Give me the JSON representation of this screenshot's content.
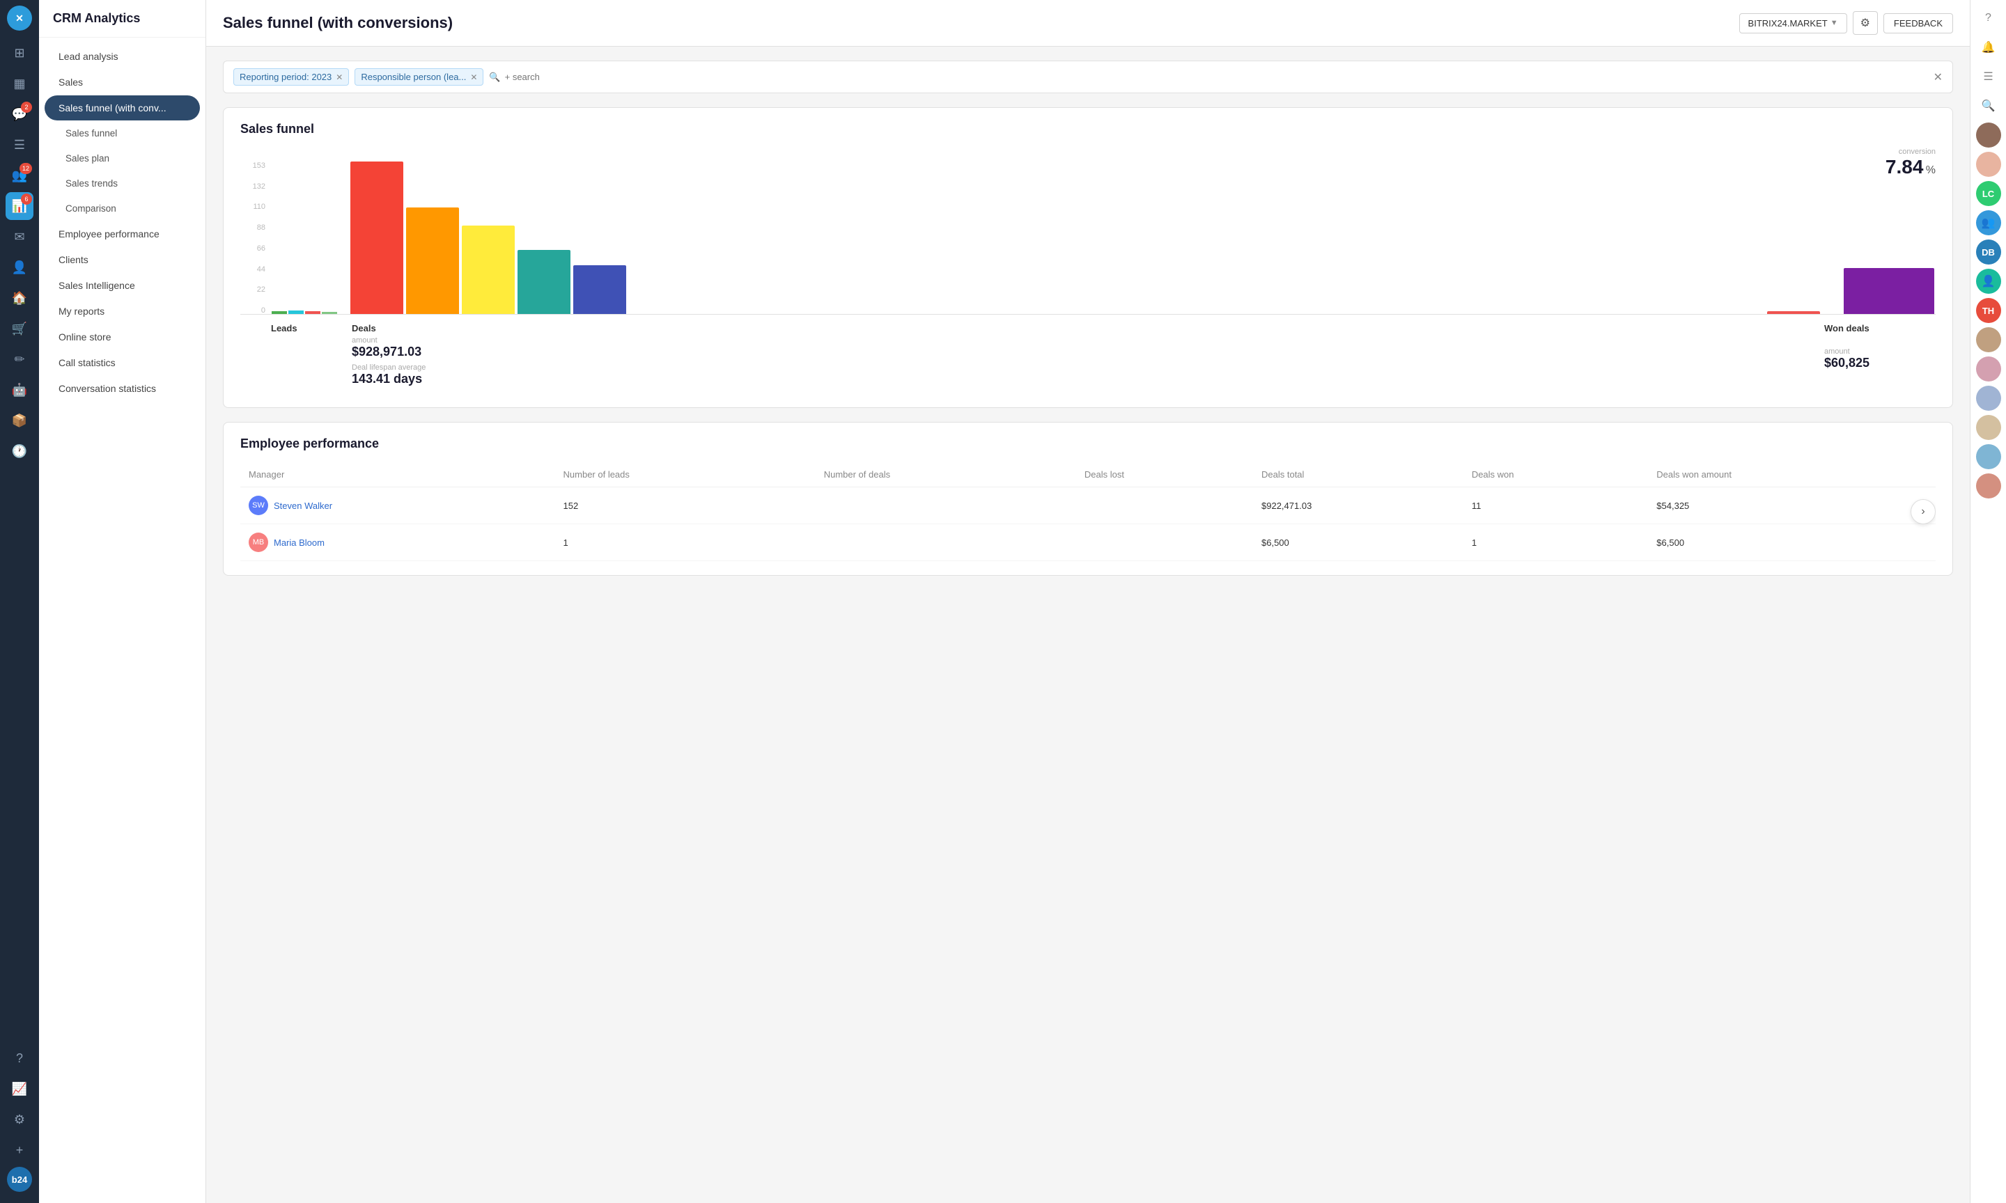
{
  "app": {
    "title": "CRM Analytics"
  },
  "header": {
    "page_title": "Sales funnel (with conversions)",
    "market_btn": "BITRIX24.MARKET",
    "feedback_btn": "FEEDBACK"
  },
  "filters": [
    {
      "label": "Reporting period: 2023",
      "id": "period"
    },
    {
      "label": "Responsible person (lea...",
      "id": "person"
    }
  ],
  "filter_placeholder": "+ search",
  "sidebar": {
    "items": [
      {
        "label": "Lead analysis",
        "id": "lead-analysis",
        "active": false,
        "sub": false
      },
      {
        "label": "Sales",
        "id": "sales",
        "active": false,
        "sub": false
      },
      {
        "label": "Sales funnel (with conv...",
        "id": "sales-funnel-conv",
        "active": true,
        "sub": false
      },
      {
        "label": "Sales funnel",
        "id": "sales-funnel",
        "active": false,
        "sub": true
      },
      {
        "label": "Sales plan",
        "id": "sales-plan",
        "active": false,
        "sub": true
      },
      {
        "label": "Sales trends",
        "id": "sales-trends",
        "active": false,
        "sub": true
      },
      {
        "label": "Comparison",
        "id": "comparison",
        "active": false,
        "sub": true
      },
      {
        "label": "Employee performance",
        "id": "employee-performance",
        "active": false,
        "sub": false
      },
      {
        "label": "Clients",
        "id": "clients",
        "active": false,
        "sub": false
      },
      {
        "label": "Sales Intelligence",
        "id": "sales-intelligence",
        "active": false,
        "sub": false
      },
      {
        "label": "My reports",
        "id": "my-reports",
        "active": false,
        "sub": false
      },
      {
        "label": "Online store",
        "id": "online-store",
        "active": false,
        "sub": false
      },
      {
        "label": "Call statistics",
        "id": "call-statistics",
        "active": false,
        "sub": false
      },
      {
        "label": "Conversation statistics",
        "id": "conversation-statistics",
        "active": false,
        "sub": false
      }
    ]
  },
  "funnel": {
    "section_title": "Sales funnel",
    "conversion_label": "conversion",
    "conversion_value": "7.84",
    "conversion_unit": "%",
    "bars": [
      {
        "label": "Leads",
        "color": "#4CAF50",
        "height_pct": 3,
        "tiny": true
      },
      {
        "label": "",
        "color": "#26C6DA",
        "height_pct": 3,
        "tiny": true
      },
      {
        "label": "",
        "color": "#EF5350",
        "height_pct": 3,
        "tiny": true
      },
      {
        "label": "",
        "color": "#81C784",
        "height_pct": 2,
        "tiny": true
      },
      {
        "label": "Deals",
        "color": "#F44336",
        "height_pct": 100,
        "tiny": false
      },
      {
        "label": "",
        "color": "#FF9800",
        "height_pct": 70,
        "tiny": false
      },
      {
        "label": "",
        "color": "#FFEB3B",
        "height_pct": 58,
        "tiny": false
      },
      {
        "label": "",
        "color": "#26A69A",
        "height_pct": 42,
        "tiny": false
      },
      {
        "label": "",
        "color": "#3F51B5",
        "height_pct": 32,
        "tiny": false
      },
      {
        "label": "",
        "color": "#EF5350",
        "height_pct": 2,
        "tiny": false
      },
      {
        "label": "",
        "color": "#EF9A9A",
        "height_pct": 2,
        "tiny": false
      },
      {
        "label": "Won deals",
        "color": "#7B1FA2",
        "height_pct": 31,
        "tiny": false
      }
    ],
    "y_labels": [
      "153",
      "132",
      "110",
      "88",
      "66",
      "44",
      "22",
      "0"
    ],
    "deals_amount_label": "amount",
    "deals_amount": "$928,971.03",
    "deal_lifespan_label": "Deal lifespan average",
    "deal_lifespan": "143.41 days",
    "won_deals_amount_label": "amount",
    "won_deals_amount": "$60,825"
  },
  "employee_performance": {
    "section_title": "Employee performance",
    "columns": [
      "Manager",
      "Number of leads",
      "Number of deals",
      "Deals lost",
      "Deals total",
      "Deals won",
      "Deals won amount"
    ],
    "rows": [
      {
        "name": "Steven Walker",
        "leads": "152",
        "deals": "",
        "lost": "",
        "total": "$922,471.03",
        "won": "11",
        "won_amount": "$54,325",
        "initials": "SW",
        "color": "#5c7cfa"
      },
      {
        "name": "Maria Bloom",
        "leads": "1",
        "deals": "",
        "lost": "",
        "total": "$6,500",
        "won": "1",
        "won_amount": "$6,500",
        "initials": "MB",
        "color": "#f77f7f"
      }
    ]
  },
  "right_panel": {
    "avatars": [
      {
        "initials": "LC",
        "color": "#2ecc71",
        "label": "LC"
      },
      {
        "initials": "DB",
        "color": "#3498db",
        "label": "DB"
      },
      {
        "initials": "TH",
        "color": "#e74c3c",
        "label": "TH"
      }
    ]
  },
  "icons": {
    "home": "⊞",
    "activity": "📊",
    "chat": "💬",
    "badge_2": "2",
    "tasks": "📋",
    "badge_12": "12",
    "clients": "👥",
    "badge_6": "6",
    "mail": "✉",
    "contacts": "👤",
    "calendar": "📅",
    "shop": "🛒",
    "robot": "🤖",
    "box": "📦",
    "clock": "🕐",
    "help": "?",
    "analytics": "📈",
    "settings": "⚙",
    "plus": "+",
    "bitrix": "B"
  }
}
